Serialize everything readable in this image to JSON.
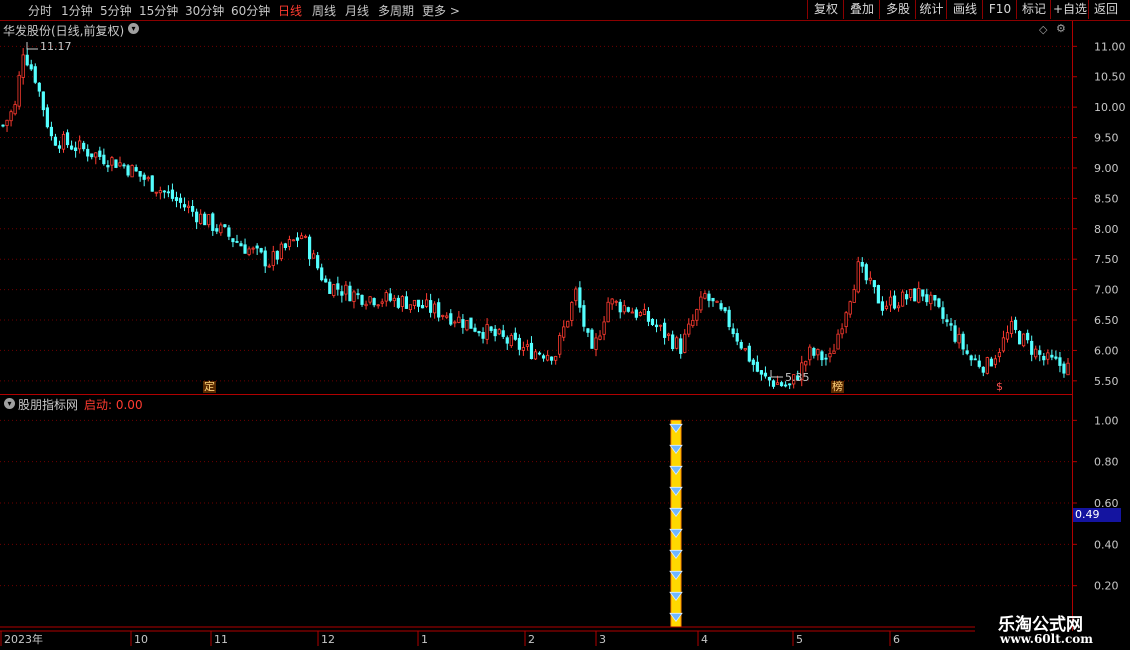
{
  "timeframes": [
    {
      "label": "分时",
      "active": false
    },
    {
      "label": "1分钟",
      "active": false
    },
    {
      "label": "5分钟",
      "active": false
    },
    {
      "label": "15分钟",
      "active": false
    },
    {
      "label": "30分钟",
      "active": false
    },
    {
      "label": "60分钟",
      "active": false
    },
    {
      "label": "日线",
      "active": true
    },
    {
      "label": "周线",
      "active": false
    },
    {
      "label": "月线",
      "active": false
    },
    {
      "label": "多周期",
      "active": false
    },
    {
      "label": "更多 >",
      "active": false
    }
  ],
  "toolbar": [
    "复权",
    "叠加",
    "多股",
    "统计",
    "画线",
    "F10",
    "标记",
    "+自选",
    "返回"
  ],
  "main_title": "华发股份(日线,前复权)",
  "sub_title": "股朋指标网",
  "sub_value_label": "启动: 0.00",
  "max_price_label": "11.17",
  "min_price_label": "5.35",
  "event_tags": [
    {
      "text": "定"
    },
    {
      "text": "榜"
    },
    {
      "text": "$"
    }
  ],
  "current_value_badge": "0.49",
  "x_axis_labels": [
    "2023年",
    "10",
    "11",
    "12",
    "1",
    "2",
    "3",
    "4",
    "5",
    "6"
  ],
  "watermark": {
    "title": "乐淘公式网",
    "url": "www.60lt.com"
  },
  "colors": {
    "up": "#ff3b30",
    "down": "#54ffff",
    "grid": "#6e0000",
    "axis": "#b00000",
    "signal": "#ffd800"
  },
  "chart_data": [
    {
      "type": "candlestick",
      "title": "华发股份(日线,前复权)",
      "ylim": [
        5.3,
        11.4
      ],
      "yticks": [
        5.5,
        6.0,
        6.5,
        7.0,
        7.5,
        8.0,
        8.5,
        9.0,
        9.5,
        10.0,
        10.5,
        11.0
      ],
      "x_labels": [
        "2023年",
        "10",
        "11",
        "12",
        "1",
        "2",
        "3",
        "4",
        "5",
        "6"
      ],
      "num_bars": 230,
      "annotations": [
        {
          "text": "11.17",
          "type": "max"
        },
        {
          "text": "5.35",
          "type": "min"
        }
      ],
      "key_points": [
        [
          0,
          9.7
        ],
        [
          3,
          10.0
        ],
        [
          5,
          10.95
        ],
        [
          8,
          10.5
        ],
        [
          12,
          9.5
        ],
        [
          20,
          9.3
        ],
        [
          30,
          9.05
        ],
        [
          40,
          8.6
        ],
        [
          50,
          8.15
        ],
        [
          60,
          7.7
        ],
        [
          66,
          7.45
        ],
        [
          74,
          7.9
        ],
        [
          80,
          7.1
        ],
        [
          88,
          6.9
        ],
        [
          100,
          6.8
        ],
        [
          110,
          6.6
        ],
        [
          120,
          6.3
        ],
        [
          130,
          6.0
        ],
        [
          137,
          5.95
        ],
        [
          142,
          6.95
        ],
        [
          146,
          5.9
        ],
        [
          150,
          6.8
        ],
        [
          155,
          6.7
        ],
        [
          160,
          6.5
        ],
        [
          168,
          6.05
        ],
        [
          174,
          6.9
        ],
        [
          180,
          6.45
        ],
        [
          188,
          5.55
        ],
        [
          195,
          5.4
        ],
        [
          200,
          5.95
        ],
        [
          205,
          5.85
        ],
        [
          212,
          7.35
        ],
        [
          218,
          6.75
        ],
        [
          228,
          6.95
        ],
        [
          235,
          6.35
        ],
        [
          240,
          5.85
        ],
        [
          244,
          5.75
        ],
        [
          250,
          6.35
        ],
        [
          258,
          5.85
        ],
        [
          265,
          5.7
        ]
      ]
    },
    {
      "type": "bar",
      "title": "股朋指标网",
      "ylim": [
        0,
        1.05
      ],
      "yticks": [
        0.2,
        0.4,
        0.6,
        0.8,
        1.0
      ],
      "current_value": 0.49,
      "signal": {
        "bar_index": 157,
        "value": 1.0,
        "label": "启动"
      }
    }
  ]
}
